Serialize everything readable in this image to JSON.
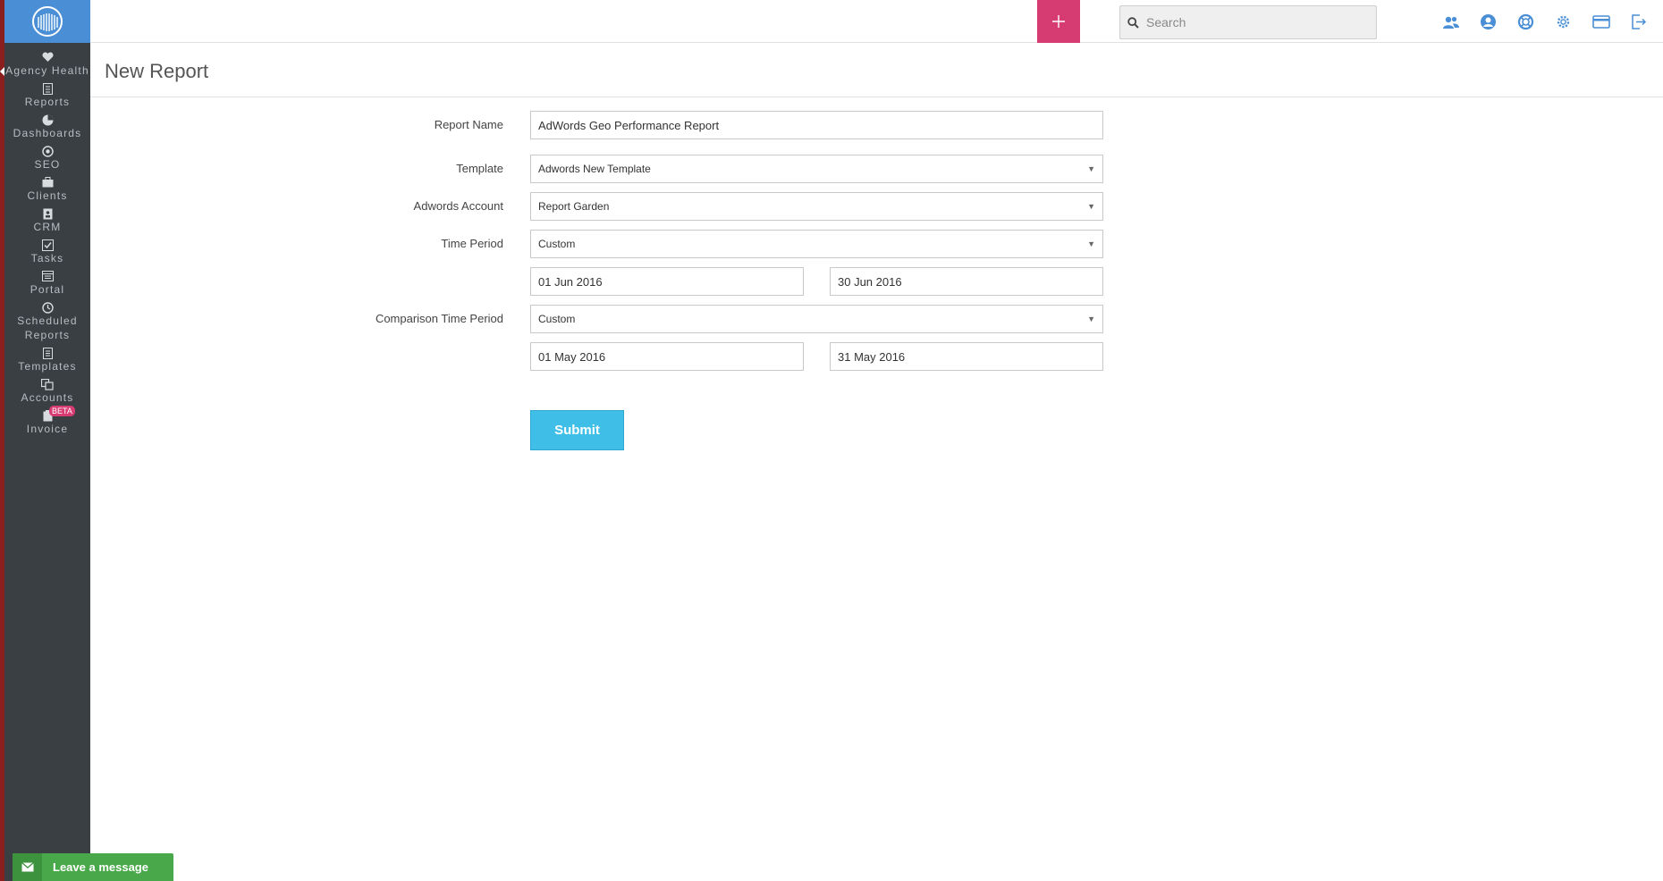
{
  "colors": {
    "sidebar_bg": "#3a3f44",
    "brand_blue": "#4a8fd6",
    "add_pink": "#d63b72",
    "submit_cyan": "#3fbfe8",
    "chat_green": "#49a849"
  },
  "sidebar": {
    "logo_icon": "reportgarden-logo-icon",
    "items": [
      {
        "id": "agency-health",
        "icon": "heart-icon",
        "label": "Agency Health"
      },
      {
        "id": "reports",
        "icon": "report-icon",
        "label": "Reports"
      },
      {
        "id": "dashboards",
        "icon": "pie-chart-icon",
        "label": "Dashboards"
      },
      {
        "id": "seo",
        "icon": "target-icon",
        "label": "SEO"
      },
      {
        "id": "clients",
        "icon": "briefcase-icon",
        "label": "Clients"
      },
      {
        "id": "crm",
        "icon": "contacts-icon",
        "label": "CRM"
      },
      {
        "id": "tasks",
        "icon": "checkbox-icon",
        "label": "Tasks"
      },
      {
        "id": "portal",
        "icon": "window-icon",
        "label": "Portal"
      },
      {
        "id": "scheduled-reports",
        "icon": "clock-icon",
        "label": "Scheduled Reports"
      },
      {
        "id": "templates",
        "icon": "document-icon",
        "label": "Templates"
      },
      {
        "id": "accounts",
        "icon": "accounts-icon",
        "label": "Accounts"
      },
      {
        "id": "invoice",
        "icon": "clipboard-icon",
        "label": "Invoice",
        "badge": "BETA"
      }
    ]
  },
  "topbar": {
    "add_label": "+",
    "search_placeholder": "Search",
    "icons": [
      "users-icon",
      "user-circle-icon",
      "lifebuoy-icon",
      "gear-icon",
      "credit-card-icon",
      "logout-icon"
    ]
  },
  "page": {
    "title": "New Report"
  },
  "form": {
    "report_name": {
      "label": "Report Name",
      "value": "AdWords Geo Performance Report"
    },
    "template": {
      "label": "Template",
      "value": "Adwords New Template"
    },
    "adwords_account": {
      "label": "Adwords Account",
      "value": "Report Garden"
    },
    "time_period": {
      "label": "Time Period",
      "value": "Custom",
      "start": "01 Jun 2016",
      "end": "30 Jun 2016"
    },
    "comparison_time_period": {
      "label": "Comparison Time Period",
      "value": "Custom",
      "start": "01 May 2016",
      "end": "31 May 2016"
    },
    "submit_label": "Submit"
  },
  "chat": {
    "label": "Leave a message",
    "icon": "envelope-icon"
  }
}
